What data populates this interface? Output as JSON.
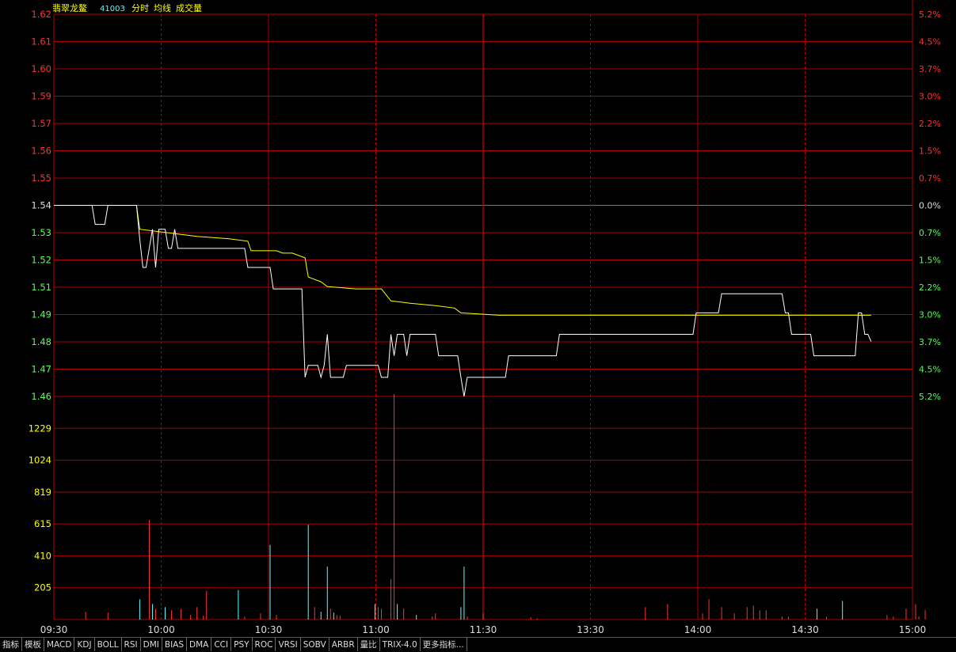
{
  "header": {
    "name": "翡翠龙鳌",
    "code": "41003",
    "view": "分时",
    "avg_label": "均线",
    "vol_label": "成交量"
  },
  "colors": {
    "background": "#000000",
    "grid": "#b00000",
    "up": "#ff3232",
    "down": "#54ff54",
    "price_line": "#ffffff",
    "avg_line": "#ffff00",
    "vol_label": "#ffff00",
    "vol_up": "#ff3232",
    "vol_down": "#54ffff",
    "neutral": "#dddddd",
    "title": "#ffff00",
    "code": "#54ffff"
  },
  "chart_data": {
    "type": "line",
    "title": "翡翠龙鳌 41003 分时",
    "base_price": 1.54,
    "x_ticks": [
      "09:30",
      "10:00",
      "10:30",
      "11:00",
      "11:30",
      "13:30",
      "14:00",
      "14:30",
      "15:00"
    ],
    "price_ticks": [
      "1.62",
      "1.61",
      "1.60",
      "1.59",
      "1.57",
      "1.56",
      "1.55",
      "1.54",
      "1.53",
      "1.52",
      "1.51",
      "1.49",
      "1.48",
      "1.47",
      "1.46"
    ],
    "pct_ticks": [
      "5.2%",
      "4.5%",
      "3.7%",
      "3.0%",
      "2.2%",
      "1.5%",
      "0.7%",
      "0.0%",
      "0.7%",
      "1.5%",
      "2.2%",
      "3.0%",
      "3.7%",
      "4.5%",
      "5.2%"
    ],
    "ylim": [
      1.46,
      1.62
    ],
    "volume_ticks": [
      "1229",
      "1024",
      "819",
      "615",
      "410",
      "205"
    ],
    "volume_ylim": [
      0,
      1434
    ],
    "series": [
      {
        "name": "分时",
        "points": [
          [
            0,
            1.54
          ],
          [
            12,
            1.54
          ],
          [
            13,
            1.532
          ],
          [
            16,
            1.532
          ],
          [
            17,
            1.54
          ],
          [
            26,
            1.54
          ],
          [
            27,
            1.526
          ],
          [
            28,
            1.514
          ],
          [
            29,
            1.514
          ],
          [
            30,
            1.522
          ],
          [
            31,
            1.53
          ],
          [
            32,
            1.514
          ],
          [
            33,
            1.53
          ],
          [
            35,
            1.53
          ],
          [
            36,
            1.522
          ],
          [
            37,
            1.522
          ],
          [
            38,
            1.53
          ],
          [
            39,
            1.522
          ],
          [
            60,
            1.522
          ],
          [
            61,
            1.514
          ],
          [
            68,
            1.514
          ],
          [
            69,
            1.505
          ],
          [
            78,
            1.505
          ],
          [
            79,
            1.468
          ],
          [
            80,
            1.473
          ],
          [
            83,
            1.473
          ],
          [
            84,
            1.468
          ],
          [
            85,
            1.473
          ],
          [
            86,
            1.486
          ],
          [
            87,
            1.468
          ],
          [
            91,
            1.468
          ],
          [
            92,
            1.473
          ],
          [
            102,
            1.473
          ],
          [
            103,
            1.468
          ],
          [
            105,
            1.468
          ],
          [
            106,
            1.486
          ],
          [
            107,
            1.477
          ],
          [
            108,
            1.486
          ],
          [
            110,
            1.486
          ],
          [
            111,
            1.477
          ],
          [
            112,
            1.486
          ],
          [
            120,
            1.486
          ],
          [
            121,
            1.477
          ],
          [
            127,
            1.477
          ],
          [
            128,
            1.468
          ],
          [
            129,
            1.46
          ],
          [
            130,
            1.468
          ],
          [
            142,
            1.468
          ],
          [
            143,
            1.477
          ],
          [
            158,
            1.477
          ],
          [
            159,
            1.486
          ],
          [
            201,
            1.486
          ],
          [
            202,
            1.495
          ],
          [
            209,
            1.495
          ],
          [
            210,
            1.503
          ],
          [
            229,
            1.503
          ],
          [
            230,
            1.495
          ],
          [
            231,
            1.495
          ],
          [
            232,
            1.486
          ],
          [
            238,
            1.486
          ],
          [
            239,
            1.477
          ],
          [
            252,
            1.477
          ],
          [
            253,
            1.495
          ],
          [
            254,
            1.495
          ],
          [
            255,
            1.486
          ],
          [
            256,
            1.486
          ],
          [
            257,
            1.483
          ]
        ]
      },
      {
        "name": "均线",
        "points": [
          [
            0,
            1.54
          ],
          [
            26,
            1.54
          ],
          [
            27,
            1.53
          ],
          [
            39,
            1.528
          ],
          [
            45,
            1.527
          ],
          [
            55,
            1.526
          ],
          [
            61,
            1.525
          ],
          [
            62,
            1.521
          ],
          [
            70,
            1.521
          ],
          [
            72,
            1.52
          ],
          [
            75,
            1.52
          ],
          [
            79,
            1.518
          ],
          [
            80,
            1.51
          ],
          [
            84,
            1.508
          ],
          [
            86,
            1.506
          ],
          [
            95,
            1.505
          ],
          [
            103,
            1.505
          ],
          [
            106,
            1.5
          ],
          [
            112,
            1.499
          ],
          [
            120,
            1.498
          ],
          [
            126,
            1.497
          ],
          [
            128,
            1.495
          ],
          [
            140,
            1.494
          ],
          [
            160,
            1.494
          ],
          [
            200,
            1.494
          ],
          [
            210,
            1.494
          ],
          [
            230,
            1.494
          ],
          [
            257,
            1.494
          ]
        ]
      }
    ],
    "volume": {
      "bars": [
        [
          10,
          50,
          "up"
        ],
        [
          17,
          45,
          "up"
        ],
        [
          27,
          130,
          "down"
        ],
        [
          30,
          640,
          "up"
        ],
        [
          31,
          100,
          "down"
        ],
        [
          32,
          70,
          "up"
        ],
        [
          35,
          80,
          "down"
        ],
        [
          37,
          60,
          "up"
        ],
        [
          40,
          70,
          "up"
        ],
        [
          43,
          30,
          "up"
        ],
        [
          45,
          80,
          "up"
        ],
        [
          47,
          25,
          "up"
        ],
        [
          48,
          185,
          "up"
        ],
        [
          58,
          190,
          "down"
        ],
        [
          60,
          20,
          "up"
        ],
        [
          65,
          40,
          "up"
        ],
        [
          68,
          480,
          "down"
        ],
        [
          70,
          30,
          "up"
        ],
        [
          80,
          610,
          "down"
        ],
        [
          82,
          80,
          "up"
        ],
        [
          84,
          50,
          "down"
        ],
        [
          86,
          340,
          "down"
        ],
        [
          87,
          70,
          "up"
        ],
        [
          88,
          45,
          "down"
        ],
        [
          89,
          30,
          "up"
        ],
        [
          90,
          25,
          "up"
        ],
        [
          101,
          100,
          "down"
        ],
        [
          102,
          80,
          "up"
        ],
        [
          103,
          70,
          "up"
        ],
        [
          106,
          260,
          "up"
        ],
        [
          107,
          1450,
          "up"
        ],
        [
          108,
          100,
          "down"
        ],
        [
          110,
          70,
          "up"
        ],
        [
          114,
          30,
          "down"
        ],
        [
          119,
          20,
          "up"
        ],
        [
          120,
          40,
          "up"
        ],
        [
          128,
          80,
          "down"
        ],
        [
          129,
          340,
          "down"
        ],
        [
          130,
          20,
          "up"
        ],
        [
          135,
          40,
          "up"
        ],
        [
          150,
          15,
          "up"
        ],
        [
          152,
          8,
          "up"
        ],
        [
          186,
          80,
          "up"
        ],
        [
          193,
          100,
          "up"
        ],
        [
          204,
          40,
          "up"
        ],
        [
          206,
          130,
          "up"
        ],
        [
          210,
          80,
          "up"
        ],
        [
          214,
          40,
          "up"
        ],
        [
          218,
          80,
          "up"
        ],
        [
          220,
          90,
          "up"
        ],
        [
          222,
          60,
          "up"
        ],
        [
          224,
          60,
          "up"
        ],
        [
          229,
          20,
          "up"
        ],
        [
          231,
          20,
          "up"
        ],
        [
          240,
          70,
          "down"
        ],
        [
          243,
          20,
          "up"
        ],
        [
          248,
          120,
          "down"
        ],
        [
          262,
          30,
          "up"
        ],
        [
          264,
          20,
          "up"
        ],
        [
          268,
          70,
          "up"
        ],
        [
          271,
          100,
          "up"
        ],
        [
          272,
          20,
          "up"
        ],
        [
          274,
          60,
          "up"
        ]
      ]
    }
  },
  "tabs": [
    "指标",
    "模板",
    "MACD",
    "KDJ",
    "BOLL",
    "RSI",
    "DMI",
    "BIAS",
    "DMA",
    "CCI",
    "PSY",
    "ROC",
    "VRSI",
    "SOBV",
    "ARBR",
    "量比",
    "TRIX-4.0",
    "更多指标..."
  ]
}
